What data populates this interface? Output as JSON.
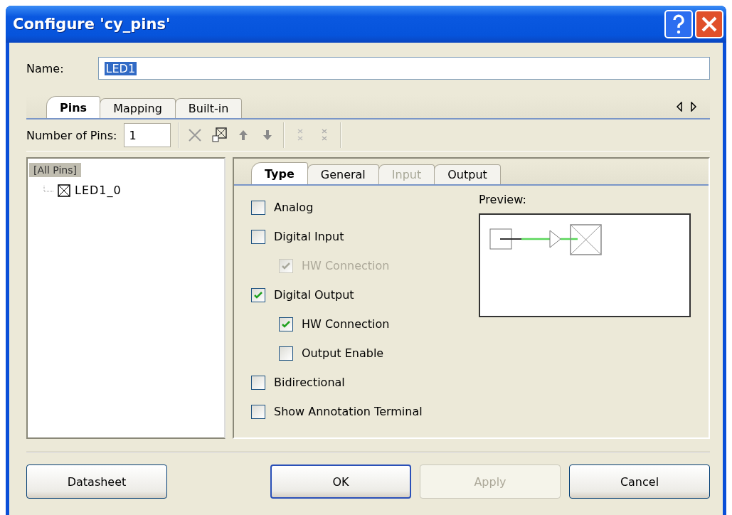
{
  "window": {
    "title": "Configure 'cy_pins'"
  },
  "name_field": {
    "label": "Name:",
    "value": "LED1",
    "value_selected": true
  },
  "tabs": [
    {
      "label": "Pins",
      "selected": true
    },
    {
      "label": "Mapping",
      "selected": false
    },
    {
      "label": "Built-in",
      "selected": false
    }
  ],
  "pins_toolbar": {
    "label": "Number of Pins:",
    "value": "1"
  },
  "tree": {
    "label": "[All Pins]",
    "selected": true,
    "children": [
      {
        "label": "LED1_0",
        "selected": false
      }
    ]
  },
  "type_tabs": [
    {
      "label": "Type",
      "selected": true,
      "disabled": false
    },
    {
      "label": "General",
      "selected": false,
      "disabled": false
    },
    {
      "label": "Input",
      "selected": false,
      "disabled": true
    },
    {
      "label": "Output",
      "selected": false,
      "disabled": false
    }
  ],
  "options": [
    {
      "label": "Analog",
      "checked": false,
      "disabled": false
    },
    {
      "label": "Digital Input",
      "checked": false,
      "disabled": false,
      "children": [
        {
          "label": "HW Connection",
          "checked": true,
          "disabled": true
        }
      ]
    },
    {
      "label": "Digital Output",
      "checked": true,
      "disabled": false,
      "children": [
        {
          "label": "HW Connection",
          "checked": true,
          "disabled": false
        },
        {
          "label": "Output Enable",
          "checked": false,
          "disabled": false
        }
      ]
    },
    {
      "label": "Bidirectional",
      "checked": false,
      "disabled": false
    },
    {
      "label": "Show Annotation Terminal",
      "checked": false,
      "disabled": false
    }
  ],
  "preview": {
    "label": "Preview:"
  },
  "buttons": [
    {
      "label": "Datasheet",
      "disabled": false,
      "default": false
    },
    {
      "label": "OK",
      "disabled": false,
      "default": true
    },
    {
      "label": "Apply",
      "disabled": true,
      "default": false
    },
    {
      "label": "Cancel",
      "disabled": false,
      "default": false
    }
  ]
}
